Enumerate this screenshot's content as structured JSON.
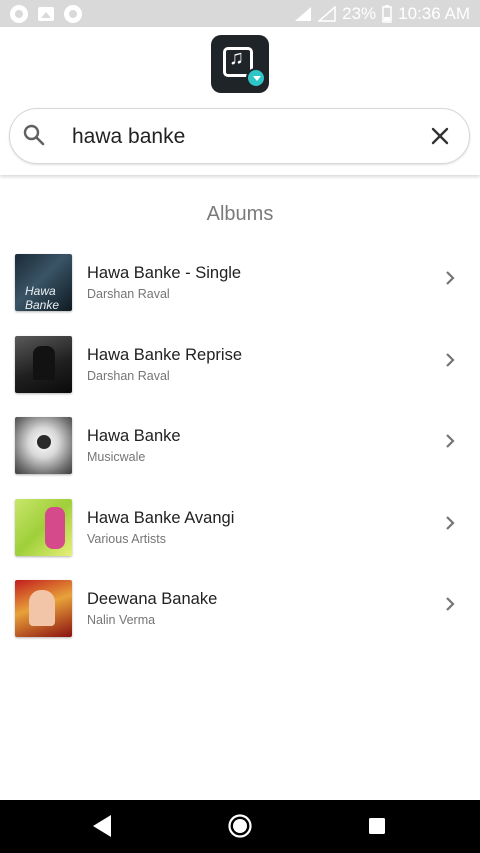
{
  "status_bar": {
    "battery": "23%",
    "time": "10:36 AM",
    "network": "4G"
  },
  "search": {
    "value": "hawa banke",
    "placeholder": ""
  },
  "section_title": "Albums",
  "albums": [
    {
      "title": "Hawa Banke - Single",
      "artist": "Darshan Raval"
    },
    {
      "title": "Hawa Banke Reprise",
      "artist": "Darshan Raval"
    },
    {
      "title": "Hawa Banke",
      "artist": "Musicwale"
    },
    {
      "title": "Hawa Banke Avangi",
      "artist": "Various Artists"
    },
    {
      "title": "Deewana Banake",
      "artist": "Nalin Verma"
    }
  ],
  "icons": {
    "search": "search-icon",
    "clear": "close-icon",
    "chevron": "chevron-right-icon",
    "back": "back-icon",
    "home": "home-icon",
    "recents": "recents-icon"
  },
  "colors": {
    "status_bar_bg": "#d9d9d9",
    "logo_bg": "#1f2429",
    "logo_accent": "#2ec5c7",
    "nav_bar_bg": "#000000"
  }
}
